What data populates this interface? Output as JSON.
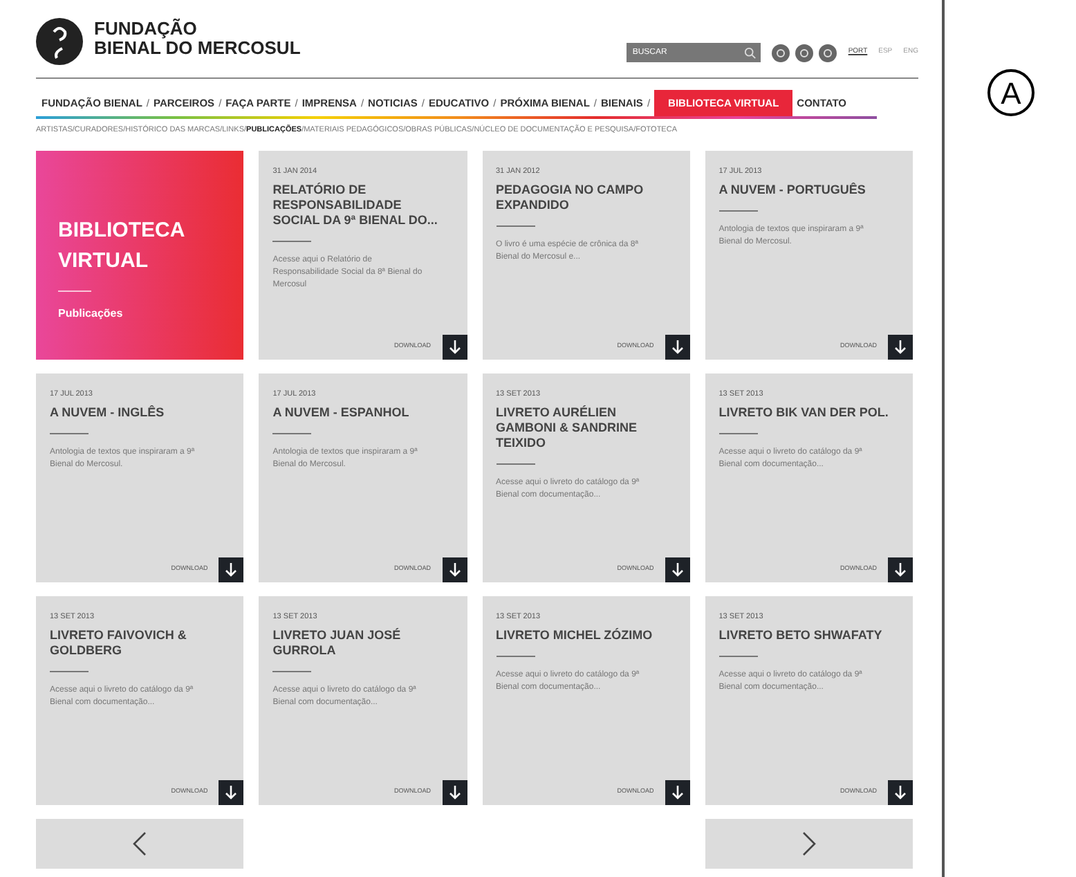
{
  "header": {
    "logo_lines": [
      "FUNDAÇÃO",
      "BIENAL DO MERCOSUL"
    ],
    "search": {
      "placeholder": "BUSCAR"
    },
    "languages": [
      {
        "label": "PORT",
        "selected": true
      },
      {
        "label": "ESP",
        "selected": false
      },
      {
        "label": "ENG",
        "selected": false
      }
    ]
  },
  "nav": [
    {
      "label": "FUNDAÇÃO BIENAL",
      "sep": "/",
      "selected": false
    },
    {
      "label": "PARCEIROS",
      "sep": "/",
      "selected": false
    },
    {
      "label": "FAÇA PARTE",
      "sep": "/",
      "selected": false
    },
    {
      "label": "IMPRENSA",
      "sep": "/",
      "selected": false
    },
    {
      "label": "NOTICIAS",
      "sep": "/",
      "selected": false
    },
    {
      "label": "EDUCATIVO",
      "sep": "/",
      "selected": false
    },
    {
      "label": "PRÓXIMA BIENAL",
      "sep": "/",
      "selected": false
    },
    {
      "label": "BIENAIS",
      "sep": "/",
      "selected": false
    },
    {
      "label": "BIBLIOTECA VIRTUAL",
      "selected": true
    },
    {
      "label": "CONTATO",
      "selected": false
    }
  ],
  "subnav": [
    {
      "label": "ARTISTAS",
      "sep": "/",
      "selected": false
    },
    {
      "label": "CURADORES",
      "sep": "/",
      "selected": false
    },
    {
      "label": "HISTÓRICO DAS MARCAS",
      "sep": "/",
      "selected": false
    },
    {
      "label": "LINKS",
      "sep": "/",
      "selected": false
    },
    {
      "label": "PUBLICAÇÕES",
      "sep": "/",
      "selected": true
    },
    {
      "label": "MATERIAIS PEDAGÓGICOS",
      "sep": "/",
      "selected": false
    },
    {
      "label": "OBRAS PÚBLICAS",
      "sep": "/",
      "selected": false
    },
    {
      "label": "NÚCLEO DE DOCUMENTAÇÃO E PESQUISA",
      "sep": "/",
      "selected": false
    },
    {
      "label": "FOTOTECA",
      "selected": false
    }
  ],
  "cards": [
    {
      "kind": "feature",
      "title": "BIBLIOTECA VIRTUAL",
      "subtitle": "Publicações"
    },
    {
      "kind": "publication",
      "date": "31 JAN 2014",
      "title": "RELATÓRIO DE RESPONSABILIDADE SOCIAL DA 9ª BIENAL DO...",
      "description": "Acesse aqui o Relatório de Responsabilidade Social da 8ª Bienal do Mercosul",
      "download": "DOWNLOAD"
    },
    {
      "kind": "publication",
      "date": "31 JAN 2012",
      "title": "PEDAGOGIA NO CAMPO EXPANDIDO",
      "description": "O livro é uma espécie de crônica da 8ª Bienal do Mercosul e...",
      "download": "DOWNLOAD"
    },
    {
      "kind": "publication",
      "date": "17 JUL 2013",
      "title": "A NUVEM - PORTUGUÊS",
      "description": "Antologia de textos que inspiraram a 9ª Bienal do Mercosul.",
      "download": "DOWNLOAD"
    },
    {
      "kind": "publication",
      "date": "17 JUL 2013",
      "title": "A NUVEM - INGLÊS",
      "description": "Antologia de textos que inspiraram a 9ª Bienal do Mercosul.",
      "download": "DOWNLOAD"
    },
    {
      "kind": "publication",
      "date": "17 JUL 2013",
      "title": "A NUVEM - ESPANHOL",
      "description": "Antologia de textos que inspiraram a 9ª Bienal do Mercosul.",
      "download": "DOWNLOAD"
    },
    {
      "kind": "publication",
      "date": "13 SET 2013",
      "title": "LIVRETO AURÉLIEN GAMBONI & SANDRINE TEIXIDO",
      "description": "Acesse aqui o livreto do catálogo da 9ª Bienal com documentação...",
      "download": "DOWNLOAD"
    },
    {
      "kind": "publication",
      "date": "13 SET 2013",
      "title": "LIVRETO BIK VAN DER POL.",
      "description": "Acesse aqui o livreto do catálogo da 9ª Bienal com documentação...",
      "download": "DOWNLOAD"
    },
    {
      "kind": "publication",
      "date": "13 SET 2013",
      "title": "LIVRETO FAIVOVICH & GOLDBERG",
      "description": "Acesse aqui o livreto do catálogo da 9ª Bienal com documentação...",
      "download": "DOWNLOAD"
    },
    {
      "kind": "publication",
      "date": "13 SET 2013",
      "title": "LIVRETO JUAN JOSÉ GURROLA",
      "description": "Acesse aqui o livreto do catálogo da 9ª Bienal com documentação...",
      "download": "DOWNLOAD"
    },
    {
      "kind": "publication",
      "date": "13 SET 2013",
      "title": "LIVRETO MICHEL ZÓZIMO",
      "description": "Acesse aqui o livreto do catálogo da 9ª Bienal com documentação...",
      "download": "DOWNLOAD"
    },
    {
      "kind": "publication",
      "date": "13 SET 2013",
      "title": "LIVRETO BETO SHWAFATY",
      "description": "Acesse aqui o livreto do catálogo da 9ª Bienal com documentação...",
      "download": "DOWNLOAD"
    }
  ],
  "figure_label": "A"
}
